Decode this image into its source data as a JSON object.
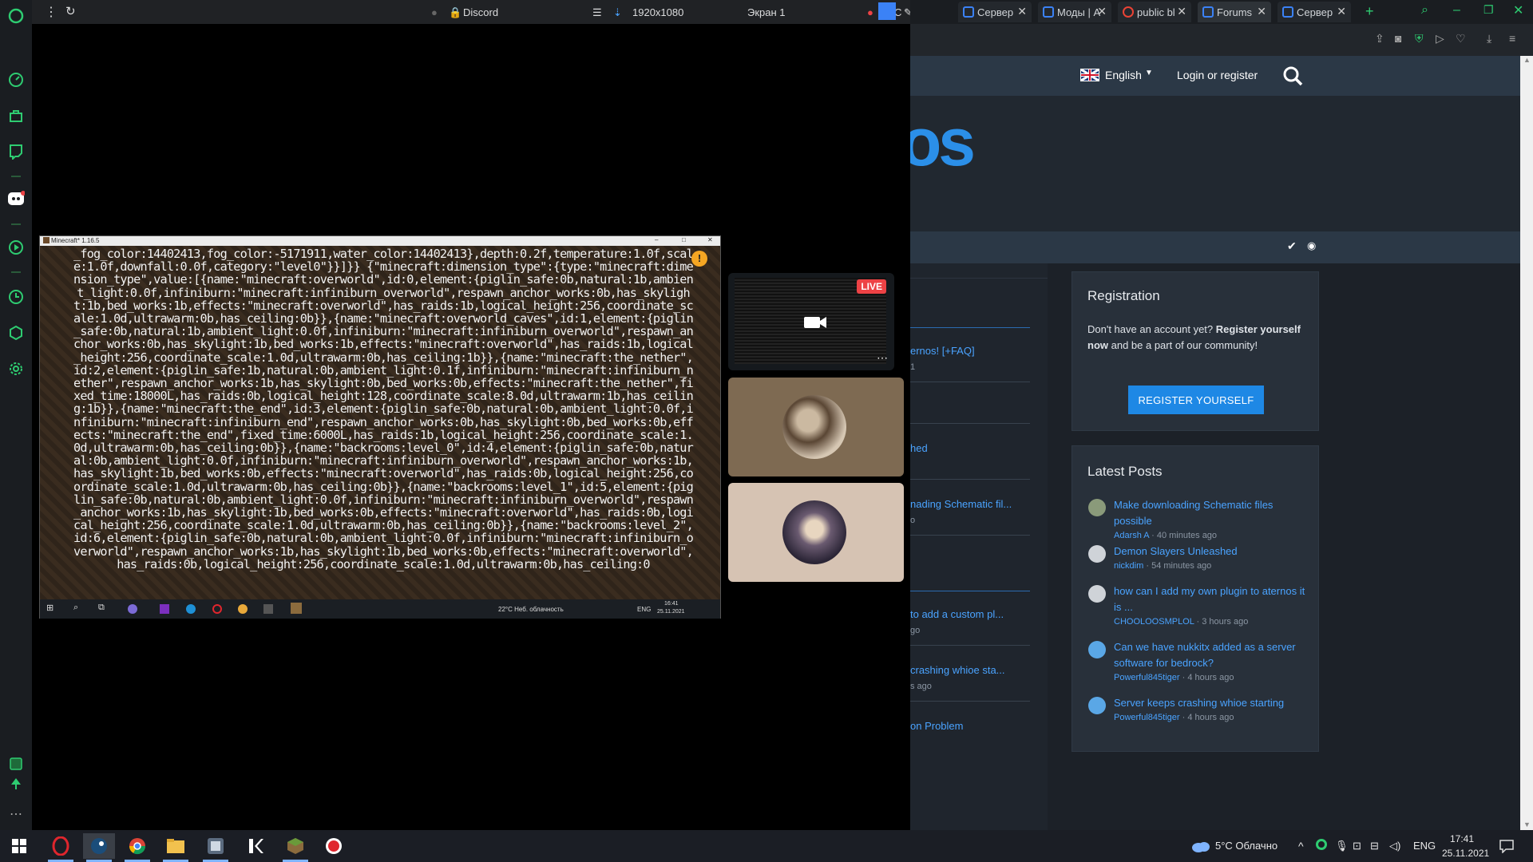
{
  "discord_bar": {
    "title": "Discord",
    "resolution": "1920x1080",
    "screen": "Экран 1",
    "rec": "REC"
  },
  "browser": {
    "tabs": [
      {
        "label": "Сервер",
        "active": false
      },
      {
        "label": "Моды | А",
        "active": false
      },
      {
        "label": "public bl",
        "active": false
      },
      {
        "label": "Forums",
        "active": true
      },
      {
        "label": "Сервер",
        "active": false
      }
    ]
  },
  "forum": {
    "language": "English",
    "login": "Login or register",
    "hero_text": "os",
    "registration": {
      "title": "Registration",
      "text_prefix": "Don't have an account yet? ",
      "text_bold": "Register yourself now",
      "text_suffix": " and be a part of our community!",
      "button": "REGISTER YOURSELF"
    },
    "latest_posts": {
      "title": "Latest Posts",
      "items": [
        {
          "title": "Make downloading Schematic files possible",
          "user": "Adarsh A",
          "time": "40 minutes ago"
        },
        {
          "title": "Demon Slayers Unleashed",
          "user": "nickdim",
          "time": "54 minutes ago"
        },
        {
          "title": "how can I add my own plugin to aternos it is ...",
          "user": "CHOOLOOSMPLOL",
          "time": "3 hours ago"
        },
        {
          "title": "Can we have nukkitx added as a server software for bedrock?",
          "user": "Powerful845tiger",
          "time": "4 hours ago"
        },
        {
          "title": "Server keeps crashing whioe starting",
          "user": "Powerful845tiger",
          "time": "4 hours ago"
        }
      ]
    },
    "partial_threads": [
      {
        "title": "ernos! [+FAQ]",
        "meta": "1"
      },
      {
        "title": "hed",
        "meta": ""
      },
      {
        "title": "nading Schematic fil...",
        "meta": "o"
      },
      {
        "title": "to add a custom pl...",
        "meta": "go"
      },
      {
        "title": "crashing whioe sta...",
        "meta": "s ago"
      },
      {
        "title": "on Problem",
        "meta": ""
      }
    ]
  },
  "minecraft": {
    "window_title": "Minecraft* 1.16.5",
    "log_text": "_fog_color:14402413,fog_color:-5171911,water_color:14402413},depth:0.2f,temperature:1.0f,scale:1.0f,downfall:0.0f,category:\"level0\"}}]}} {\"minecraft:dimension_type\":{type:\"minecraft:dimension_type\",value:[{name:\"minecraft:overworld\",id:0,element:{piglin_safe:0b,natural:1b,ambient_light:0.0f,infiniburn:\"minecraft:infiniburn_overworld\",respawn_anchor_works:0b,has_skylight:1b,bed_works:1b,effects:\"minecraft:overworld\",has_raids:1b,logical_height:256,coordinate_scale:1.0d,ultrawarm:0b,has_ceiling:0b}},{name:\"minecraft:overworld_caves\",id:1,element:{piglin_safe:0b,natural:1b,ambient_light:0.0f,infiniburn:\"minecraft:infiniburn_overworld\",respawn_anchor_works:0b,has_skylight:1b,bed_works:1b,effects:\"minecraft:overworld\",has_raids:1b,logical_height:256,coordinate_scale:1.0d,ultrawarm:0b,has_ceiling:1b}},{name:\"minecraft:the_nether\",id:2,element:{piglin_safe:1b,natural:0b,ambient_light:0.1f,infiniburn:\"minecraft:infiniburn_nether\",respawn_anchor_works:1b,has_skylight:0b,bed_works:0b,effects:\"minecraft:the_nether\",fixed_time:18000L,has_raids:0b,logical_height:128,coordinate_scale:8.0d,ultrawarm:1b,has_ceiling:1b}},{name:\"minecraft:the_end\",id:3,element:{piglin_safe:0b,natural:0b,ambient_light:0.0f,infiniburn:\"minecraft:infiniburn_end\",respawn_anchor_works:0b,has_skylight:0b,bed_works:0b,effects:\"minecraft:the_end\",fixed_time:6000L,has_raids:1b,logical_height:256,coordinate_scale:1.0d,ultrawarm:0b,has_ceiling:0b}},{name:\"backrooms:level_0\",id:4,element:{piglin_safe:0b,natural:0b,ambient_light:0.0f,infiniburn:\"minecraft:infiniburn_overworld\",respawn_anchor_works:1b,has_skylight:1b,bed_works:0b,effects:\"minecraft:overworld\",has_raids:0b,logical_height:256,coordinate_scale:1.0d,ultrawarm:0b,has_ceiling:0b}},{name:\"backrooms:level_1\",id:5,element:{piglin_safe:0b,natural:0b,ambient_light:0.0f,infiniburn:\"minecraft:infiniburn_overworld\",respawn_anchor_works:1b,has_skylight:1b,bed_works:0b,effects:\"minecraft:overworld\",has_raids:0b,logical_height:256,coordinate_scale:1.0d,ultrawarm:0b,has_ceiling:0b}},{name:\"backrooms:level_2\",id:6,element:{piglin_safe:0b,natural:0b,ambient_light:0.0f,infiniburn:\"minecraft:infiniburn_overworld\",respawn_anchor_works:1b,has_skylight:1b,bed_works:0b,effects:\"minecraft:overworld\",has_raids:0b,logical_height:256,coordinate_scale:1.0d,ultrawarm:0b,has_ceiling:0",
    "taskbar_weather": "22°C Неб. облачность",
    "taskbar_lang": "ENG",
    "taskbar_time": "16:41",
    "taskbar_date": "25.11.2021"
  },
  "discord_tiles": {
    "live": "LIVE"
  },
  "windows_taskbar": {
    "weather": "5°C Облачно",
    "lang": "ENG",
    "time": "17:41",
    "date": "25.11.2021"
  },
  "colors": {
    "accent_blue": "#4aa3ff",
    "button_blue": "#1e88e5",
    "live_red": "#ed4245",
    "opera_green": "#2ecc71"
  }
}
